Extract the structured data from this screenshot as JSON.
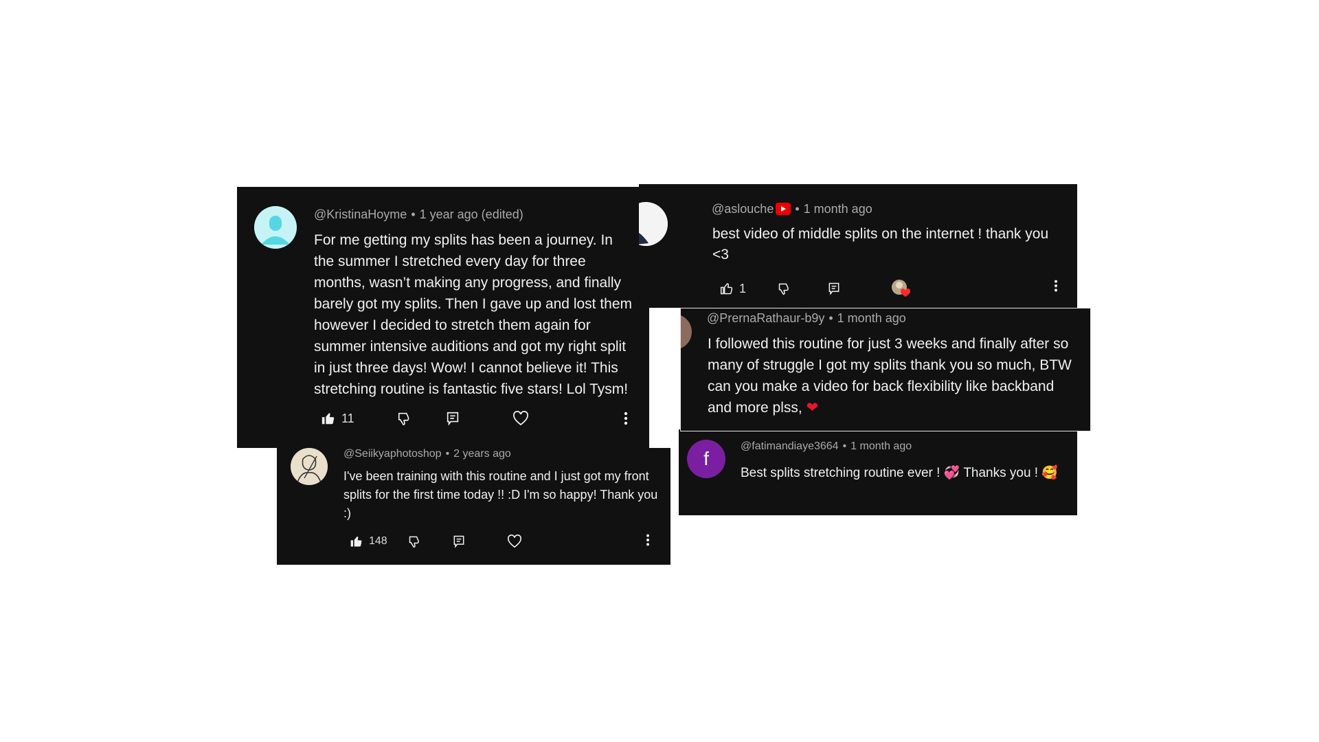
{
  "comments": {
    "kristina": {
      "handle": "@KristinaHoyme",
      "time": "1 year ago (edited)",
      "text": "For me getting my splits has been a journey. In the summer I stretched every day for three months, wasn’t making any progress, and finally barely got my splits. Then I gave up and lost them however I decided to stretch them again for summer intensive auditions and got my right split in just three days! Wow! I cannot believe it! This stretching routine is fantastic five stars! Lol Tysm!",
      "likes": "11"
    },
    "seiikya": {
      "handle": "@Seiikyaphotoshop",
      "time": "2 years ago",
      "text": "I've been training with this routine and I just got my front splits for the first time today !! :D I'm so happy! Thank you :)",
      "likes": "148"
    },
    "aslouche": {
      "handle": "@aslouche",
      "time": "1 month ago",
      "text": "best video of middle splits on the internet ! thank you <3",
      "likes": "1"
    },
    "prerna": {
      "handle": "@PrernaRathaur-b9y",
      "time": "1 month ago",
      "text": "I followed this routine for just 3 weeks and finally after so many of struggle I got my splits thank you so much, BTW can you make a video for back flexibility like backband and more plss,",
      "emoji": "❤"
    },
    "fatima": {
      "handle": "@fatimandiaye3664",
      "time": "1 month ago",
      "avatar_letter": "f",
      "text_a": "Best splits stretching routine ever !",
      "emoji_a": "💞",
      "text_b": "Thanks you !",
      "emoji_b": "🥰"
    }
  },
  "colors": {
    "card_bg": "#111111",
    "meta": "#aaaaaa",
    "text": "#f1f1f1",
    "fatima_avatar": "#7b1fa2",
    "kristina_avatar": "#bdf0f0",
    "yt_red": "#ee0000"
  },
  "icons": [
    "thumbs-up-icon",
    "thumbs-down-icon",
    "reply-icon",
    "heart-icon",
    "more-vert-icon",
    "youtube-badge-icon",
    "user-placeholder-icon"
  ]
}
